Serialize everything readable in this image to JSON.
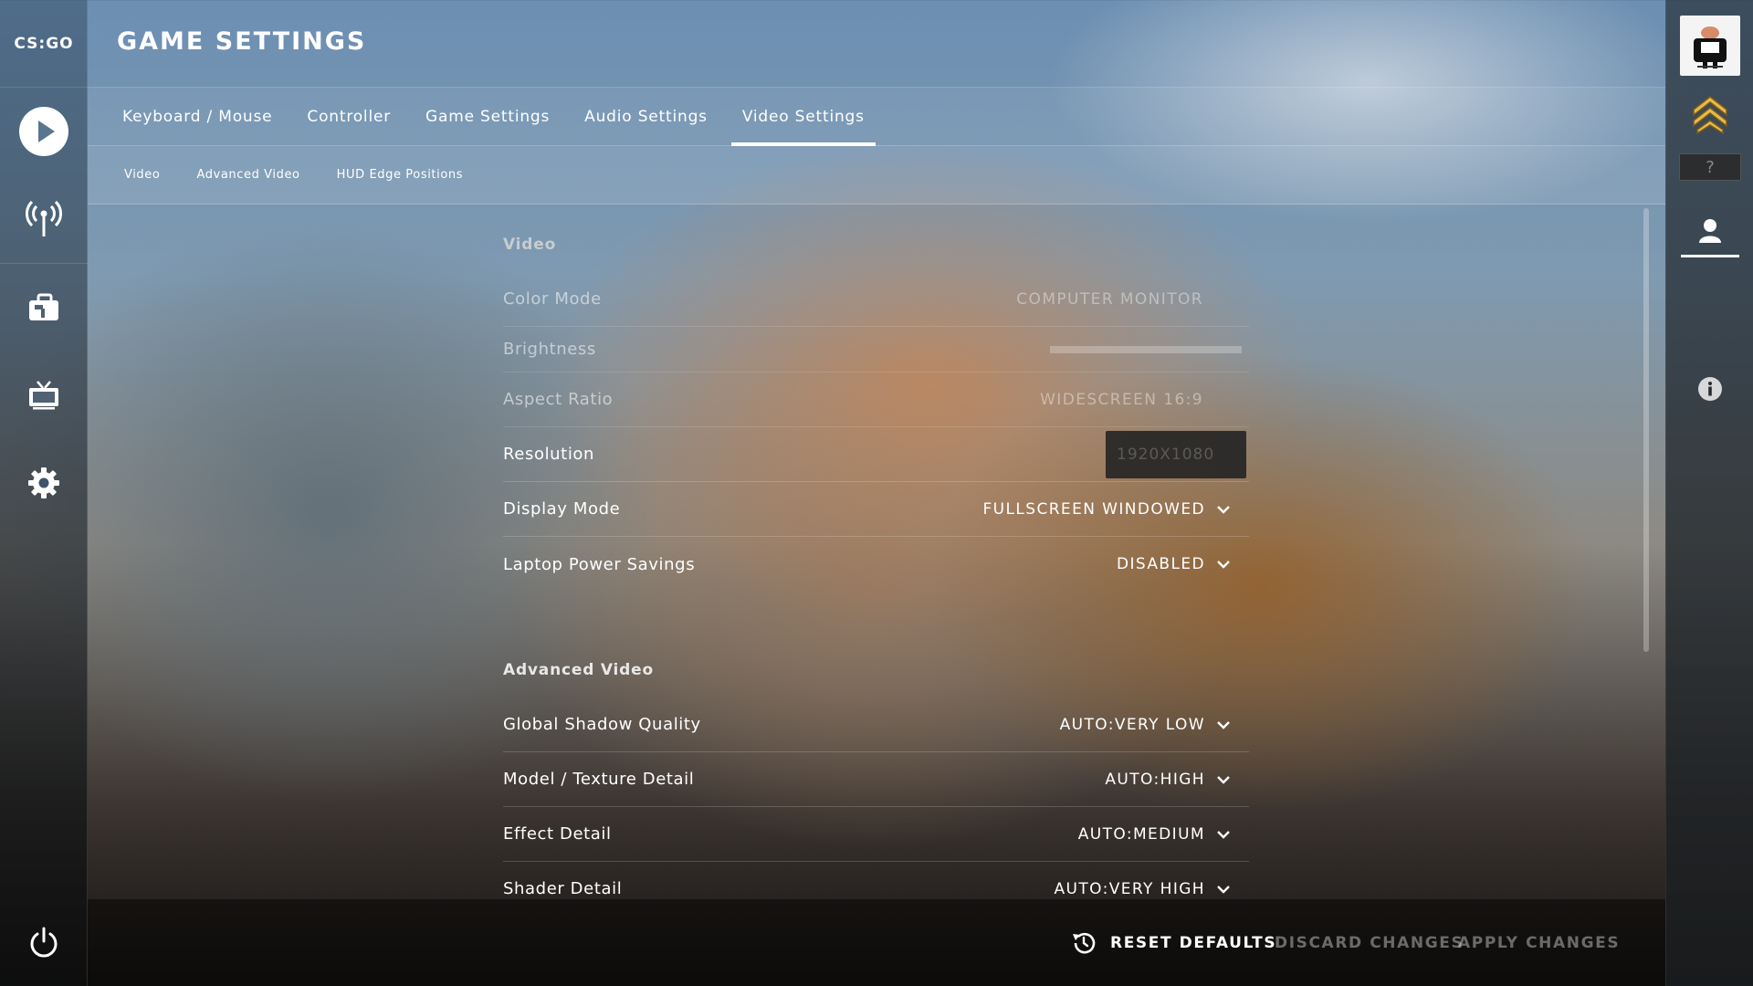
{
  "app": {
    "logo_text": "CS:GO"
  },
  "left_nav": {
    "items": [
      {
        "name": "play",
        "icon": "play-icon"
      },
      {
        "name": "watch",
        "icon": "broadcast-icon"
      },
      {
        "name": "inventory",
        "icon": "briefcase-icon"
      },
      {
        "name": "tv",
        "icon": "tv-icon"
      },
      {
        "name": "settings",
        "icon": "gear-icon"
      }
    ],
    "power_icon": "power-icon"
  },
  "header": {
    "title": "GAME SETTINGS"
  },
  "tabs": [
    {
      "label": "Keyboard / Mouse",
      "active": false
    },
    {
      "label": "Controller",
      "active": false
    },
    {
      "label": "Game Settings",
      "active": false
    },
    {
      "label": "Audio Settings",
      "active": false
    },
    {
      "label": "Video Settings",
      "active": true
    }
  ],
  "subtabs": [
    {
      "label": "Video"
    },
    {
      "label": "Advanced Video"
    },
    {
      "label": "HUD Edge Positions"
    }
  ],
  "video_section": {
    "title": "Video",
    "color_mode": {
      "label": "Color Mode",
      "value": "COMPUTER MONITOR"
    },
    "brightness": {
      "label": "Brightness",
      "level": 0.0
    },
    "aspect_ratio": {
      "label": "Aspect Ratio",
      "value": "WIDESCREEN 16:9"
    },
    "resolution": {
      "label": "Resolution",
      "value": "1920X1080"
    },
    "display_mode": {
      "label": "Display Mode",
      "value": "FULLSCREEN WINDOWED"
    },
    "laptop_power": {
      "label": "Laptop Power Savings",
      "value": "DISABLED"
    }
  },
  "advanced_section": {
    "title": "Advanced Video",
    "shadow": {
      "label": "Global Shadow Quality",
      "value": "AUTO:VERY LOW"
    },
    "model_texture": {
      "label": "Model / Texture Detail",
      "value": "AUTO:HIGH"
    },
    "effect": {
      "label": "Effect Detail",
      "value": "AUTO:MEDIUM"
    },
    "shader": {
      "label": "Shader Detail",
      "value": "AUTO:VERY HIGH"
    }
  },
  "footer": {
    "reset": "RESET DEFAULTS",
    "discard": "DISCARD CHANGES",
    "apply": "APPLY CHANGES"
  },
  "right_rail": {
    "unknown_rank": "?"
  },
  "colors": {
    "accent": "#ffffff",
    "muted_text": "#8c9095"
  }
}
